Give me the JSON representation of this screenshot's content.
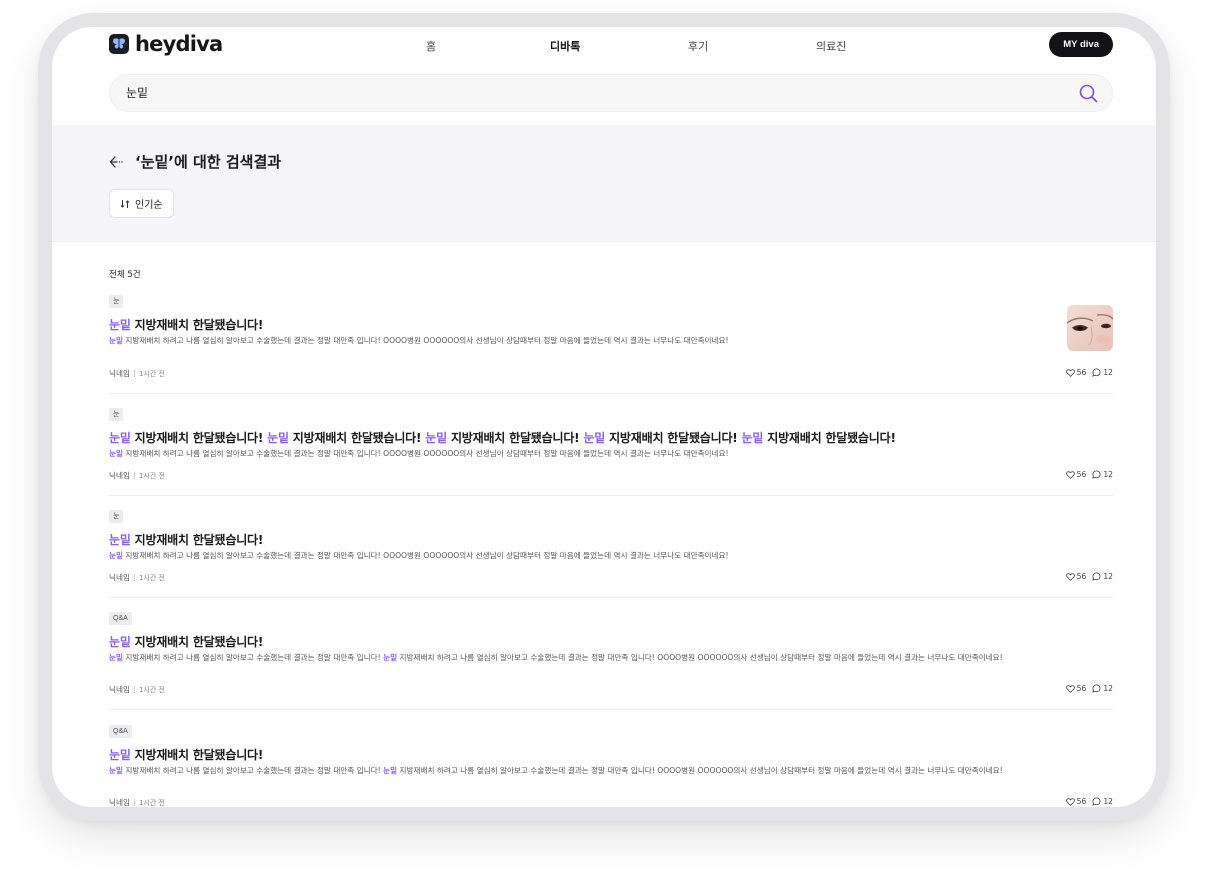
{
  "header": {
    "brand": "heydiva",
    "nav": [
      "홈",
      "디바톡",
      "후기",
      "의료진"
    ],
    "my_button": "MY diva"
  },
  "search": {
    "value": "눈밑"
  },
  "results": {
    "title": "‘눈밑’에 대한 검색결과",
    "sort_label": "인기순",
    "total_label": "전체 5건"
  },
  "posts": [
    {
      "tag": "눈",
      "title_kw": "눈밑",
      "title_rest": " 지방재배치 한달됐습니다!",
      "body_kw": "눈밑",
      "body_rest": " 지방재배치 하려고 나름 열심히 알아보고 수술했는데 결과는 정말 대만족 입니다! OOOO병원 OOOOOO의사 선생님이 상담때부터 정말 마음에 들었는데 역시 결과는 너무나도 대만족이네요!",
      "author": "닉네임",
      "time": "1시간 전",
      "likes": "56",
      "comments": "12",
      "has_thumbnail": true
    },
    {
      "tag": "눈",
      "title_parts": [
        {
          "kw": "눈밑",
          "rest": " 지방재배치 한달됐습니다! "
        },
        {
          "kw": "눈밑",
          "rest": " 지방재배치 한달됐습니다! "
        },
        {
          "kw": "눈밑",
          "rest": " 지방재배치 한달됐습니다! "
        },
        {
          "kw": "눈밑",
          "rest": " 지방재배치 한달됐습니다! "
        },
        {
          "kw": "눈밑",
          "rest": " 지방재배치 한달됐습니다!"
        }
      ],
      "body_kw": "눈밑",
      "body_rest": " 지방재배치 하려고 나름 열심히 알아보고 수술했는데 결과는 정말 대만족 입니다! OOOO병원 OOOOOO의사 선생님이 상담때부터 정말 마음에 들었는데 역시 결과는 너무나도 대만족이네요!",
      "author": "닉네임",
      "time": "1시간 전",
      "likes": "56",
      "comments": "12"
    },
    {
      "tag": "눈",
      "title_kw": "눈밑",
      "title_rest": " 지방재배치 한달됐습니다!",
      "body_kw": "눈밑",
      "body_rest": " 지방재배치 하려고 나름 열심히 알아보고 수술했는데 결과는 정말 대만족 입니다! OOOO병원 OOOOOO의사 선생님이 상담때부터 정말 마음에 들었는데 역시 결과는 너무나도 대만족이네요!",
      "author": "닉네임",
      "time": "1시간 전",
      "likes": "56",
      "comments": "12"
    },
    {
      "tag": "Q&A",
      "title_kw": "눈밑",
      "title_rest": " 지방재배치 한달됐습니다!",
      "body_kw": "눈밑",
      "body_mid": " 지방재배치 하려고 나름 열심히 알아보고 수술했는데 결과는 정말 대만족 입니다! ",
      "body_kw2": "눈밑",
      "body_rest": " 지방재배치 하려고 나름 열심히 알아보고 수술했는데 결과는 정말 대만족 입니다! OOOO병원 OOOOOO의사 선생님이 상담때부터 정말 마음에 들었는데 역시 결과는 너무나도 대만족이네요!",
      "author": "닉네임",
      "time": "1시간 전",
      "likes": "56",
      "comments": "12"
    },
    {
      "tag": "Q&A",
      "title_kw": "눈밑",
      "title_rest": " 지방재배치 한달됐습니다!",
      "body_kw": "눈밑",
      "body_mid": " 지방재배치 하려고 나름 열심히 알아보고 수술했는데 결과는 정말 대만족 입니다! ",
      "body_kw2": "눈밑",
      "body_rest": " 지방재배치 하려고 나름 열심히 알아보고 수술했는데 결과는 정말 대만족 입니다! OOOO병원 OOOOOO의사 선생님이 상담때부터 정말 마음에 들었는데 역시 결과는 너무나도 대만족이네요!",
      "author": "닉네임",
      "time": "1시간 전",
      "likes": "56",
      "comments": "12"
    }
  ],
  "colors": {
    "accent": "#8a5cf5",
    "header_bg": "#f5f5f7",
    "my_button_bg": "#121217"
  }
}
